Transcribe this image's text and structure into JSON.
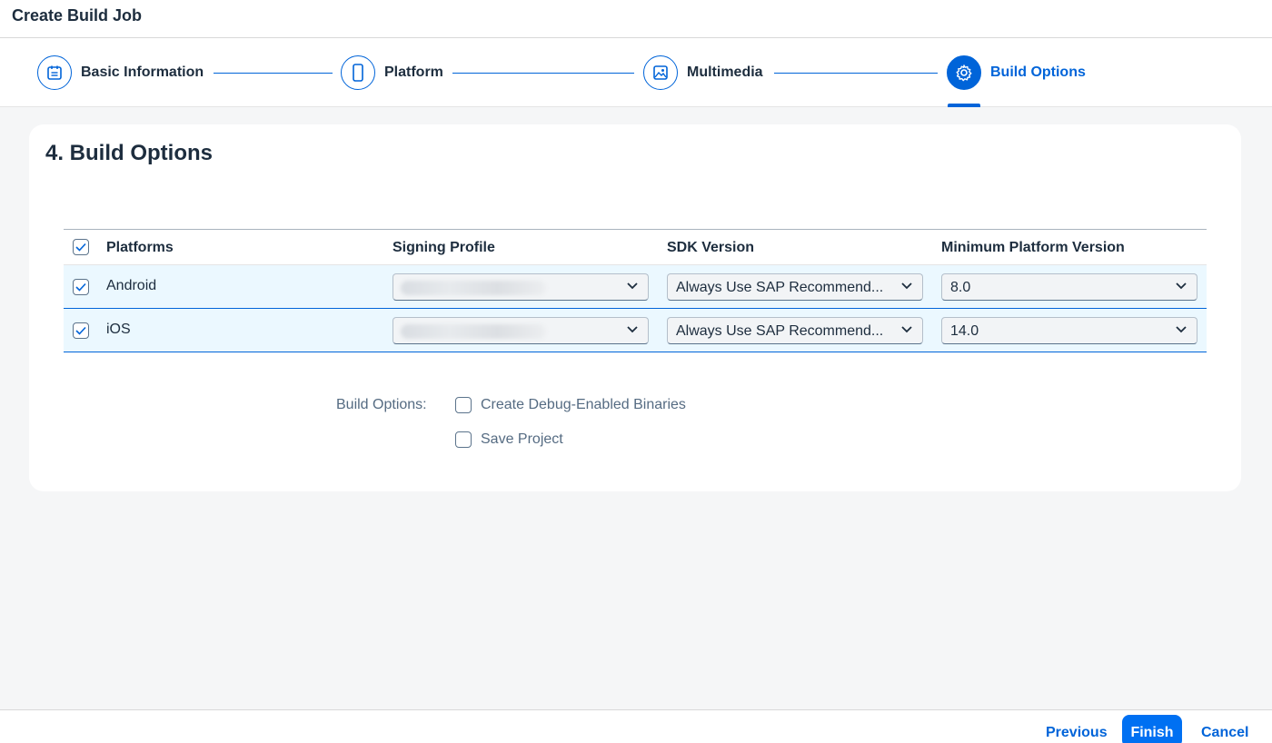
{
  "header": {
    "title": "Create Build Job"
  },
  "wizard": {
    "steps": [
      {
        "label": "Basic Information",
        "icon": "calendar-icon"
      },
      {
        "label": "Platform",
        "icon": "phone-icon"
      },
      {
        "label": "Multimedia",
        "icon": "image-icon"
      },
      {
        "label": "Build Options",
        "icon": "gear-icon",
        "active": true
      }
    ]
  },
  "section": {
    "title": "4. Build Options"
  },
  "table": {
    "columns": [
      "Platforms",
      "Signing Profile",
      "SDK Version",
      "Minimum Platform Version"
    ],
    "rows": [
      {
        "platform": "Android",
        "checked": true,
        "signing_profile": "",
        "sdk_version": "Always Use SAP Recommend...",
        "min_version": "8.0"
      },
      {
        "platform": "iOS",
        "checked": true,
        "signing_profile": "",
        "sdk_version": "Always Use SAP Recommend...",
        "min_version": "14.0"
      }
    ],
    "header_checked": true
  },
  "build_options": {
    "label": "Build Options:",
    "options": [
      {
        "label": "Create Debug-Enabled Binaries",
        "checked": false
      },
      {
        "label": "Save Project",
        "checked": false
      }
    ]
  },
  "footer": {
    "previous": "Previous",
    "finish": "Finish",
    "cancel": "Cancel"
  },
  "colors": {
    "accent": "#0064d9",
    "primary_button": "#0070f2",
    "row_selected": "#ebf8ff"
  }
}
